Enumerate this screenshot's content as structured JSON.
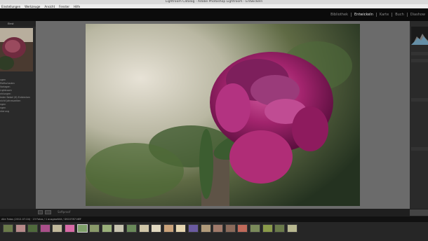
{
  "window": {
    "title": "Lightroom Catalog - Adobe Photoshop Lightroom - Entwickeln"
  },
  "menu": [
    "Einstellungen",
    "Werkzeuge",
    "Ansicht",
    "Fenster",
    "Hilfe"
  ],
  "modules": [
    "Bibliothek",
    "Entwickeln",
    "Karte",
    "Buch",
    "Diashow"
  ],
  "active_module": "Entwickeln",
  "navigator": {
    "label": "Einst"
  },
  "left_items": [
    "ugen",
    "Mofischaden",
    "Vorlagen",
    "Lightroom",
    "nhlungen",
    "",
    "",
    "",
    "leder Nebel (6) Entdecken",
    "nicht Jahreszeiten",
    "",
    "ngen",
    "",
    "",
    "",
    "ngen",
    "nterung"
  ],
  "toolbar": {
    "softproof": "Softproof"
  },
  "status": {
    "text": "Alle Fotos (2012-07-04) · 23 Fotos / 1 ausgewählt / DSC0787.NEF"
  },
  "filmstrip": {
    "count": 24,
    "selected": 6
  }
}
